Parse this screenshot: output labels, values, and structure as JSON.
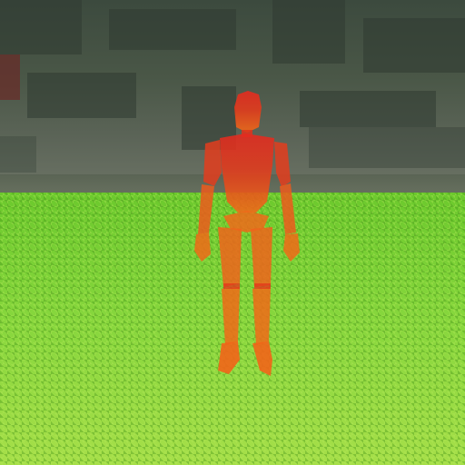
{
  "scene": {
    "type": "3d-game-viewport",
    "character": "red-mannequin"
  },
  "colors": {
    "character_top": "#e52a1f",
    "character_bottom": "#f06a18",
    "grass_base": "#7fd03a",
    "wall": "#4a5747"
  }
}
